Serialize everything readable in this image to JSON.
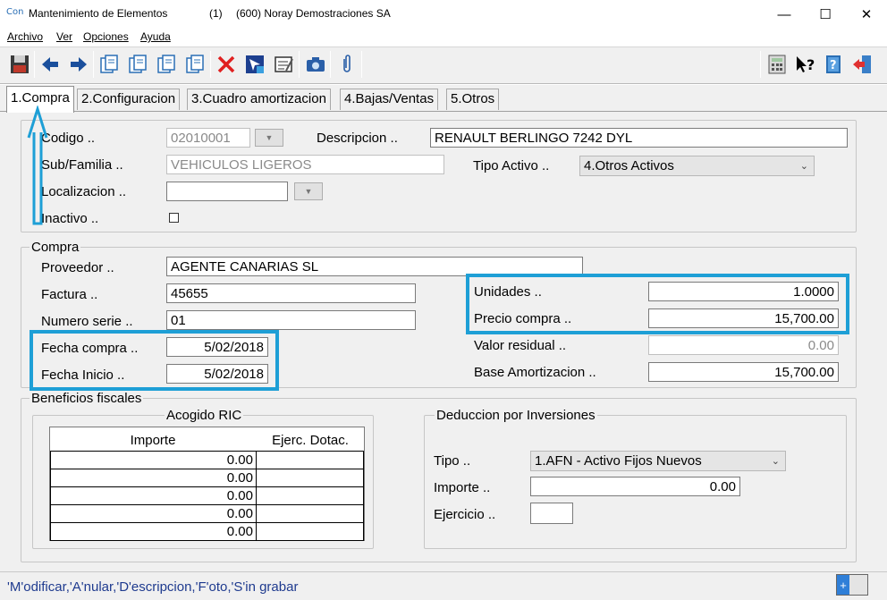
{
  "window": {
    "app_icon_text": "Con",
    "title": "Mantenimiento de Elementos",
    "count": "(1)",
    "company": "(600) Noray Demostraciones SA",
    "minimize": "—",
    "maximize": "☐",
    "close": "✕"
  },
  "menu": [
    "Archivo",
    "Ver",
    "Opciones",
    "Ayuda"
  ],
  "tabs": [
    "1.Compra",
    "2.Configuracion",
    "3.Cuadro amortizacion",
    "4.Bajas/Ventas",
    "5.Otros"
  ],
  "header": {
    "codigo_label": "Codigo ..",
    "codigo_value": "02010001",
    "descripcion_label": "Descripcion ..",
    "descripcion_value": "RENAULT BERLINGO 7242 DYL",
    "subfamilia_label": "Sub/Familia ..",
    "subfamilia_value": "VEHICULOS LIGEROS",
    "tipo_activo_label": "Tipo Activo ..",
    "tipo_activo_value": "4.Otros Activos",
    "localizacion_label": "Localizacion ..",
    "localizacion_value": "",
    "inactivo_label": "Inactivo .."
  },
  "compra": {
    "title": "Compra",
    "proveedor_label": "Proveedor ..",
    "proveedor_value": "AGENTE CANARIAS SL",
    "factura_label": "Factura ..",
    "factura_value": "45655",
    "numero_serie_label": "Numero serie ..",
    "numero_serie_value": "01",
    "fecha_compra_label": "Fecha compra ..",
    "fecha_compra_value": "5/02/2018",
    "fecha_inicio_label": "Fecha Inicio ..",
    "fecha_inicio_value": "5/02/2018",
    "unidades_label": "Unidades ..",
    "unidades_value": "1.0000",
    "precio_compra_label": "Precio compra ..",
    "precio_compra_value": "15,700.00",
    "valor_residual_label": "Valor residual ..",
    "valor_residual_value": "0.00",
    "base_amortizacion_label": "Base Amortizacion ..",
    "base_amortizacion_value": "15,700.00"
  },
  "beneficios": {
    "title": "Beneficios fiscales",
    "ric_title": "Acogido RIC",
    "ric_headers": [
      "Importe",
      "Ejerc. Dotac."
    ],
    "ric_rows": [
      {
        "importe": "0.00",
        "ejerc": ""
      },
      {
        "importe": "0.00",
        "ejerc": ""
      },
      {
        "importe": "0.00",
        "ejerc": ""
      },
      {
        "importe": "0.00",
        "ejerc": ""
      },
      {
        "importe": "0.00",
        "ejerc": ""
      }
    ],
    "deduccion_title": "Deduccion por Inversiones",
    "tipo_label": "Tipo ..",
    "tipo_value": "1.AFN - Activo Fijos Nuevos",
    "importe_label": "Importe ..",
    "importe_value": "0.00",
    "ejercicio_label": "Ejercicio ..",
    "ejercicio_value": ""
  },
  "status": {
    "text": "'M'odificar,'A'nular,'D'escripcion,'F'oto,'S'in grabar",
    "button_symbol": "+"
  },
  "colors": {
    "highlight": "#1e9fd6",
    "status_text": "#1f3b8f"
  }
}
